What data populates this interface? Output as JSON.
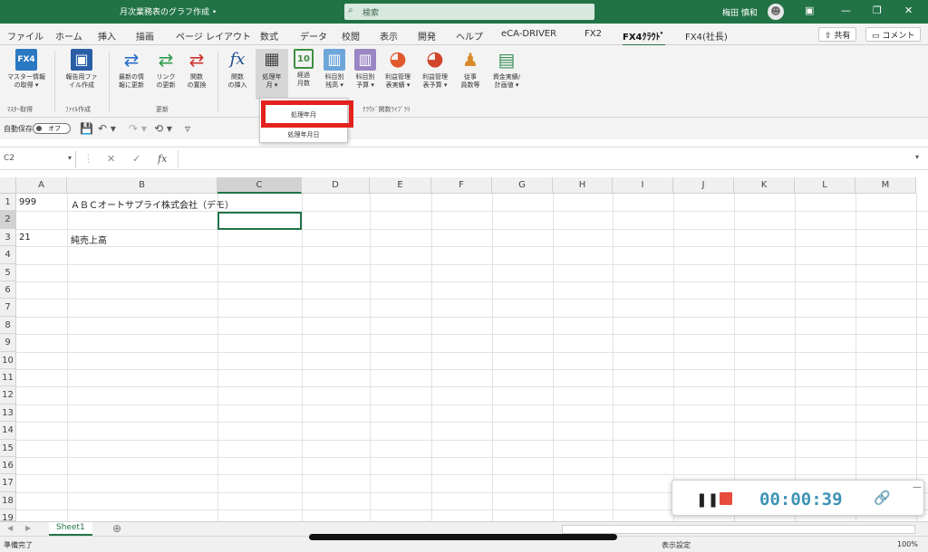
{
  "titlebar": {
    "title": "月次業務表のグラフ作成 •",
    "search": "検索",
    "user": "梅田 慎和",
    "avatar": "☻",
    "btn_ribbon": "▣",
    "btn_min": "—",
    "btn_max": "❐",
    "btn_close": "✕"
  },
  "menu": {
    "tabs": [
      "ファイル",
      "ホーム",
      "挿入",
      "描画",
      "ページ レイアウト",
      "数式",
      "データ",
      "校閲",
      "表示",
      "開発",
      "ヘルプ",
      "eCA-DRIVER",
      "FX2",
      "FX4ｸﾗｳﾄﾞ",
      "FX4(社長)"
    ],
    "active_tab": "FX4ｸﾗｳﾄﾞ",
    "share": "共有",
    "comment": "コメント"
  },
  "ribbon": {
    "buttons": [
      {
        "label1": "マスター情報",
        "label2": "の取得 ▾",
        "color": "#2b78c2",
        "glyph": "FX4"
      },
      {
        "label1": "報告用ファ",
        "label2": "イル作成",
        "color": "#2a5fa8",
        "glyph": "▣"
      },
      {
        "label1": "最新の情",
        "label2": "報に更新",
        "color": "#2a6fc9",
        "glyph": "⇄"
      },
      {
        "label1": "リンク",
        "label2": "の更新",
        "color": "#2e9c4e",
        "glyph": "⇄"
      },
      {
        "label1": "関数",
        "label2": "の置換",
        "color": "#d0342c",
        "glyph": "⇄"
      },
      {
        "label1": "関数",
        "label2": "の挿入",
        "color": "#ffffff",
        "glyph": "fx"
      },
      {
        "label1": "処理年",
        "label2": "月 ▾",
        "color": "#8a8a8a",
        "glyph": "▦"
      },
      {
        "label1": "経過",
        "label2": "月数",
        "color": "#3f8f3f",
        "glyph": "10"
      },
      {
        "label1": "科目別",
        "label2": "残高 ▾",
        "color": "#6ea6d9",
        "glyph": "▥"
      },
      {
        "label1": "科目別",
        "label2": "予算 ▾",
        "color": "#9a86c4",
        "glyph": "▥"
      },
      {
        "label1": "利益管理",
        "label2": "表実績 ▾",
        "color": "#e0582c",
        "glyph": "◕"
      },
      {
        "label1": "利益管理",
        "label2": "表予算 ▾",
        "color": "#d0442c",
        "glyph": "◕"
      },
      {
        "label1": "従事",
        "label2": "員数等",
        "color": "#d98a2b",
        "glyph": "♟"
      },
      {
        "label1": "資金実績/",
        "label2": "計画値 ▾",
        "color": "#3a8f5a",
        "glyph": "▤"
      }
    ],
    "groups": [
      "ﾏｽﾀｰ取得",
      "ﾌｧｲﾙ作成",
      "更新",
      "ｸﾗｳﾄﾞ関数ﾗｲﾌﾞﾗﾘ"
    ]
  },
  "qat": {
    "autosave_label": "自動保存",
    "toggle": "オフ",
    "save_icon": "💾",
    "undo_icon": "↶ ▾",
    "redo_icon": "↷ ▾",
    "extra_icon": "⟲ ▾",
    "more_icon": "▿"
  },
  "dropdown": {
    "items": [
      "処理年月",
      "処理年月日"
    ]
  },
  "formula": {
    "namebox": "C2",
    "namebox_arrow": "▾",
    "cancel": "✕",
    "enter": "✓",
    "fx": "fx",
    "expand": "▾"
  },
  "grid": {
    "columns": [
      "A",
      "B",
      "C",
      "D",
      "E",
      "F",
      "G",
      "H",
      "I",
      "J",
      "K",
      "L",
      "M"
    ],
    "selected_column": "C",
    "rows": [
      "1",
      "2",
      "3",
      "4",
      "5",
      "6",
      "7",
      "8",
      "9",
      "10",
      "11",
      "12",
      "13",
      "14",
      "15",
      "16",
      "17",
      "18",
      "19"
    ],
    "cells": {
      "A1": "999",
      "B1": "ＡＢＣオートサプライ株式会社（デモ）",
      "A3": "21",
      "B3": "純売上高"
    }
  },
  "sheets": {
    "active": "Sheet1",
    "add": "⊕",
    "nav_left": "◀",
    "nav_right": "▶"
  },
  "status": {
    "ready": "準備完了",
    "display_settings": "表示設定",
    "zoom": "100%"
  },
  "recorder": {
    "pause": "❚❚",
    "time": "00:00:39",
    "link": "🔗",
    "minimize": "—"
  }
}
